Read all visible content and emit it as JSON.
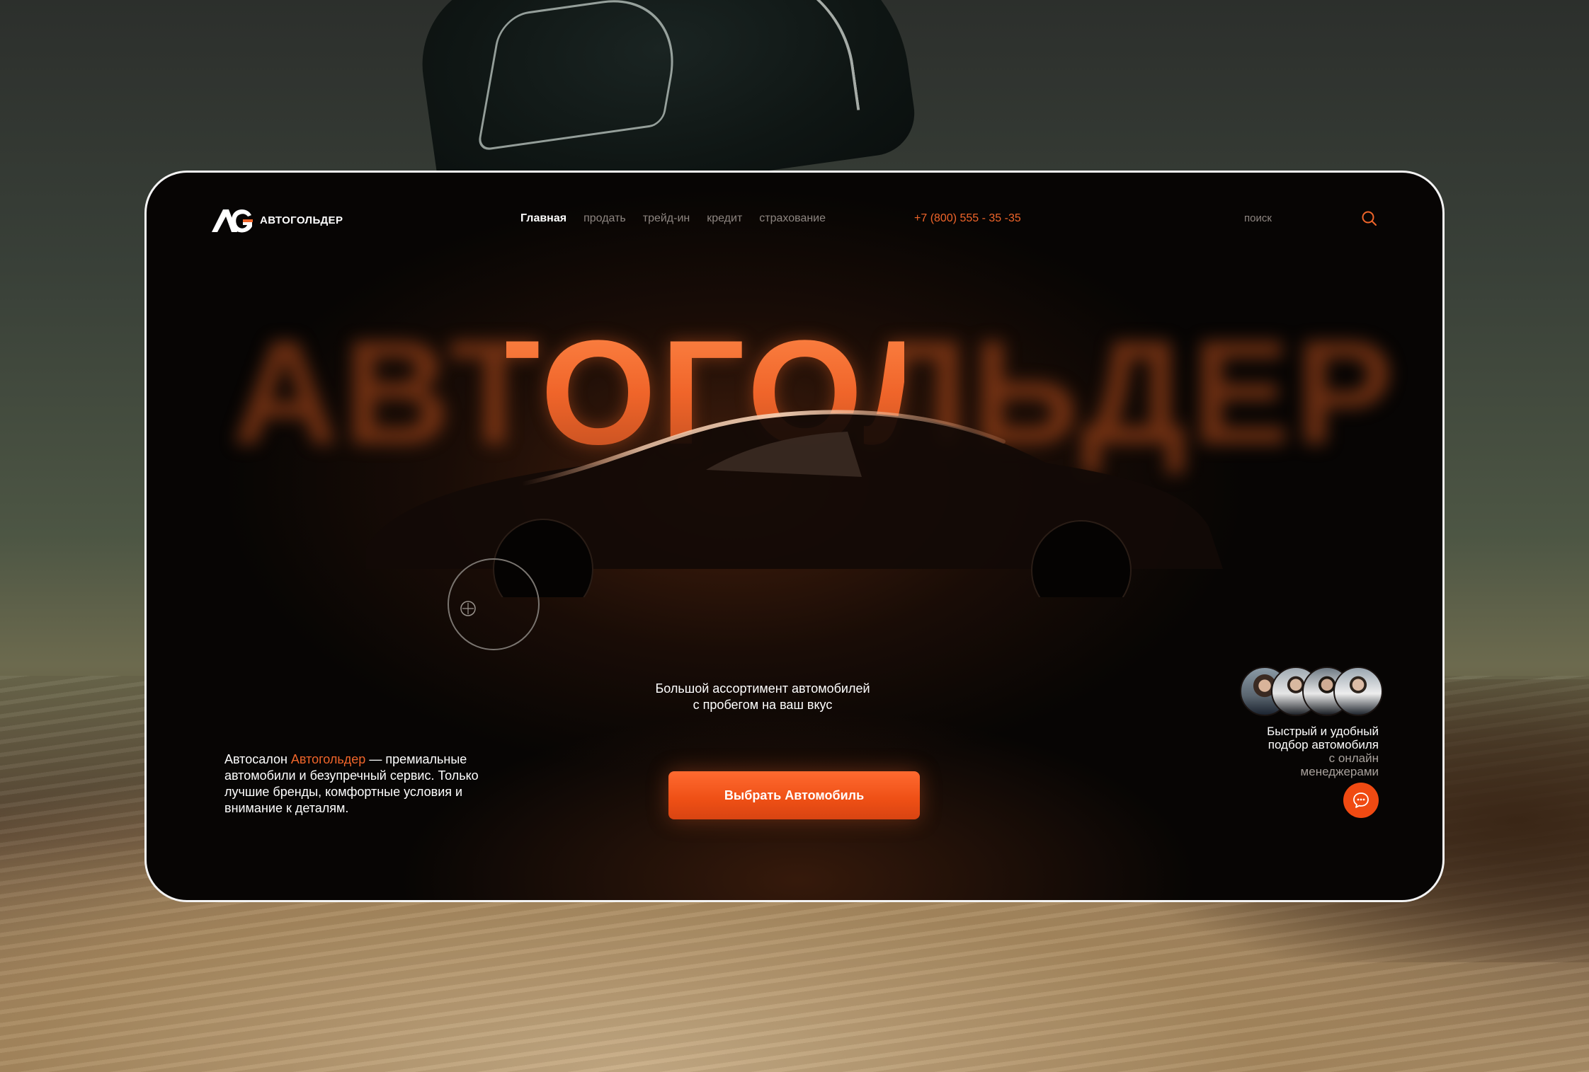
{
  "brand": {
    "logo_text": "АВТОГОЛЬДЕР",
    "mark": "AG"
  },
  "nav": {
    "items": [
      {
        "label": "Главная",
        "active": true
      },
      {
        "label": "продать",
        "active": false
      },
      {
        "label": "трейд-ин",
        "active": false
      },
      {
        "label": "кредит",
        "active": false
      },
      {
        "label": "страхование",
        "active": false
      }
    ]
  },
  "header": {
    "phone": "+7 (800) 555 - 35 -35",
    "search_label": "поиск",
    "search_icon": "search-icon"
  },
  "hero": {
    "background_word": "АВТОГОЛЬДЕР",
    "left_prefix": "Автосалон ",
    "left_brand": "Автогольдер",
    "left_rest": " — премиальные автомобили и безупречный сервис. Только лучшие бренды, комфортные условия и внимание к деталям.",
    "center_line1": "Большой ассортимент автомобилей",
    "center_line2": "с пробегом на ваш вкус",
    "cta_label": "Выбрать Автомобиль"
  },
  "managers": {
    "line1": "Быстрый и удобный",
    "line2": "подбор автомобиля",
    "line3": "с онлайн",
    "line4": "менеджерами",
    "chat_icon": "chat-icon"
  },
  "colors": {
    "accent": "#f0652a",
    "background": "#070504",
    "text": "#ffffff",
    "muted": "#8d8580"
  }
}
